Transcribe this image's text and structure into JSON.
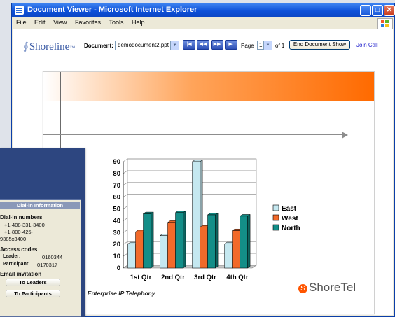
{
  "window": {
    "title": "Document Viewer - Microsoft Internet Explorer"
  },
  "menu": [
    "File",
    "Edit",
    "View",
    "Favorites",
    "Tools",
    "Help"
  ],
  "brand": {
    "logo": "Shoreline",
    "tm": "™"
  },
  "toolbar": {
    "document_label": "Document:",
    "document_value": "demodocument2.ppt",
    "page_label": "Page",
    "page_value": "1",
    "of_label": "of 1",
    "end_show": "End Document Show",
    "join_call": "Join Call"
  },
  "slide": {
    "tagline": "g Innovation in Enterprise IP Telephony",
    "brand": "ShoreTel"
  },
  "dialin": {
    "header": "Dial-in Information",
    "numbers_label": "Dial-in numbers",
    "number1": "+1-408-331-3400",
    "number2a": "+1-800-425-",
    "number2b": "9385x3400",
    "codes_label": "Access codes",
    "leader_label": "Leader:",
    "leader_code": "0160344",
    "participant_label": "Participant:",
    "participant_code": "0170317",
    "invite_label": "Email invitation",
    "to_leaders": "To Leaders",
    "to_participants": "To Participants"
  },
  "chart_data": {
    "type": "bar",
    "categories": [
      "1st Qtr",
      "2nd Qtr",
      "3rd Qtr",
      "4th Qtr"
    ],
    "series": [
      {
        "name": "East",
        "values": [
          20.4,
          27.4,
          90,
          20.4
        ],
        "color": "#c5e8f0"
      },
      {
        "name": "West",
        "values": [
          30.6,
          38.6,
          34.6,
          31.6
        ],
        "color": "#f26a2a"
      },
      {
        "name": "North",
        "values": [
          45.9,
          46.9,
          45,
          43.9
        ],
        "color": "#138e88"
      }
    ],
    "ylim": [
      0,
      90
    ],
    "yticks": [
      0,
      10,
      20,
      30,
      40,
      50,
      60,
      70,
      80,
      90
    ],
    "grid": true,
    "legend": "right"
  }
}
